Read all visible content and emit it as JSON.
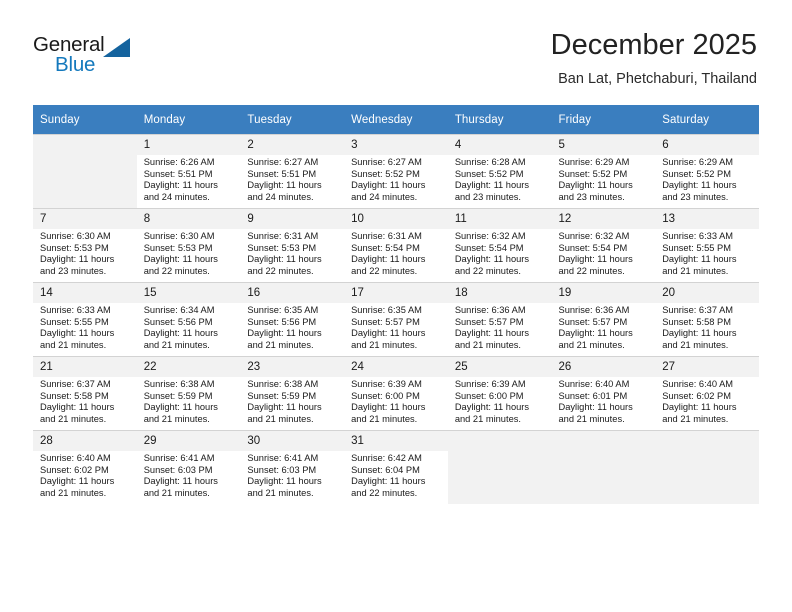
{
  "brand": {
    "name_top": "General",
    "name_bottom": "Blue",
    "accent_color": "#1479bd",
    "triangle_color": "#14639e"
  },
  "header": {
    "month_title": "December 2025",
    "location": "Ban Lat, Phetchaburi, Thailand"
  },
  "calendar": {
    "header_bg": "#3a7ebf",
    "weekday_headers": [
      "Sunday",
      "Monday",
      "Tuesday",
      "Wednesday",
      "Thursday",
      "Friday",
      "Saturday"
    ],
    "weeks": [
      [
        {
          "day": "",
          "sunrise": "",
          "sunset": "",
          "daylight_line1": "",
          "daylight_line2": ""
        },
        {
          "day": "1",
          "sunrise": "Sunrise: 6:26 AM",
          "sunset": "Sunset: 5:51 PM",
          "daylight_line1": "Daylight: 11 hours",
          "daylight_line2": "and 24 minutes."
        },
        {
          "day": "2",
          "sunrise": "Sunrise: 6:27 AM",
          "sunset": "Sunset: 5:51 PM",
          "daylight_line1": "Daylight: 11 hours",
          "daylight_line2": "and 24 minutes."
        },
        {
          "day": "3",
          "sunrise": "Sunrise: 6:27 AM",
          "sunset": "Sunset: 5:52 PM",
          "daylight_line1": "Daylight: 11 hours",
          "daylight_line2": "and 24 minutes."
        },
        {
          "day": "4",
          "sunrise": "Sunrise: 6:28 AM",
          "sunset": "Sunset: 5:52 PM",
          "daylight_line1": "Daylight: 11 hours",
          "daylight_line2": "and 23 minutes."
        },
        {
          "day": "5",
          "sunrise": "Sunrise: 6:29 AM",
          "sunset": "Sunset: 5:52 PM",
          "daylight_line1": "Daylight: 11 hours",
          "daylight_line2": "and 23 minutes."
        },
        {
          "day": "6",
          "sunrise": "Sunrise: 6:29 AM",
          "sunset": "Sunset: 5:52 PM",
          "daylight_line1": "Daylight: 11 hours",
          "daylight_line2": "and 23 minutes."
        }
      ],
      [
        {
          "day": "7",
          "sunrise": "Sunrise: 6:30 AM",
          "sunset": "Sunset: 5:53 PM",
          "daylight_line1": "Daylight: 11 hours",
          "daylight_line2": "and 23 minutes."
        },
        {
          "day": "8",
          "sunrise": "Sunrise: 6:30 AM",
          "sunset": "Sunset: 5:53 PM",
          "daylight_line1": "Daylight: 11 hours",
          "daylight_line2": "and 22 minutes."
        },
        {
          "day": "9",
          "sunrise": "Sunrise: 6:31 AM",
          "sunset": "Sunset: 5:53 PM",
          "daylight_line1": "Daylight: 11 hours",
          "daylight_line2": "and 22 minutes."
        },
        {
          "day": "10",
          "sunrise": "Sunrise: 6:31 AM",
          "sunset": "Sunset: 5:54 PM",
          "daylight_line1": "Daylight: 11 hours",
          "daylight_line2": "and 22 minutes."
        },
        {
          "day": "11",
          "sunrise": "Sunrise: 6:32 AM",
          "sunset": "Sunset: 5:54 PM",
          "daylight_line1": "Daylight: 11 hours",
          "daylight_line2": "and 22 minutes."
        },
        {
          "day": "12",
          "sunrise": "Sunrise: 6:32 AM",
          "sunset": "Sunset: 5:54 PM",
          "daylight_line1": "Daylight: 11 hours",
          "daylight_line2": "and 22 minutes."
        },
        {
          "day": "13",
          "sunrise": "Sunrise: 6:33 AM",
          "sunset": "Sunset: 5:55 PM",
          "daylight_line1": "Daylight: 11 hours",
          "daylight_line2": "and 21 minutes."
        }
      ],
      [
        {
          "day": "14",
          "sunrise": "Sunrise: 6:33 AM",
          "sunset": "Sunset: 5:55 PM",
          "daylight_line1": "Daylight: 11 hours",
          "daylight_line2": "and 21 minutes."
        },
        {
          "day": "15",
          "sunrise": "Sunrise: 6:34 AM",
          "sunset": "Sunset: 5:56 PM",
          "daylight_line1": "Daylight: 11 hours",
          "daylight_line2": "and 21 minutes."
        },
        {
          "day": "16",
          "sunrise": "Sunrise: 6:35 AM",
          "sunset": "Sunset: 5:56 PM",
          "daylight_line1": "Daylight: 11 hours",
          "daylight_line2": "and 21 minutes."
        },
        {
          "day": "17",
          "sunrise": "Sunrise: 6:35 AM",
          "sunset": "Sunset: 5:57 PM",
          "daylight_line1": "Daylight: 11 hours",
          "daylight_line2": "and 21 minutes."
        },
        {
          "day": "18",
          "sunrise": "Sunrise: 6:36 AM",
          "sunset": "Sunset: 5:57 PM",
          "daylight_line1": "Daylight: 11 hours",
          "daylight_line2": "and 21 minutes."
        },
        {
          "day": "19",
          "sunrise": "Sunrise: 6:36 AM",
          "sunset": "Sunset: 5:57 PM",
          "daylight_line1": "Daylight: 11 hours",
          "daylight_line2": "and 21 minutes."
        },
        {
          "day": "20",
          "sunrise": "Sunrise: 6:37 AM",
          "sunset": "Sunset: 5:58 PM",
          "daylight_line1": "Daylight: 11 hours",
          "daylight_line2": "and 21 minutes."
        }
      ],
      [
        {
          "day": "21",
          "sunrise": "Sunrise: 6:37 AM",
          "sunset": "Sunset: 5:58 PM",
          "daylight_line1": "Daylight: 11 hours",
          "daylight_line2": "and 21 minutes."
        },
        {
          "day": "22",
          "sunrise": "Sunrise: 6:38 AM",
          "sunset": "Sunset: 5:59 PM",
          "daylight_line1": "Daylight: 11 hours",
          "daylight_line2": "and 21 minutes."
        },
        {
          "day": "23",
          "sunrise": "Sunrise: 6:38 AM",
          "sunset": "Sunset: 5:59 PM",
          "daylight_line1": "Daylight: 11 hours",
          "daylight_line2": "and 21 minutes."
        },
        {
          "day": "24",
          "sunrise": "Sunrise: 6:39 AM",
          "sunset": "Sunset: 6:00 PM",
          "daylight_line1": "Daylight: 11 hours",
          "daylight_line2": "and 21 minutes."
        },
        {
          "day": "25",
          "sunrise": "Sunrise: 6:39 AM",
          "sunset": "Sunset: 6:00 PM",
          "daylight_line1": "Daylight: 11 hours",
          "daylight_line2": "and 21 minutes."
        },
        {
          "day": "26",
          "sunrise": "Sunrise: 6:40 AM",
          "sunset": "Sunset: 6:01 PM",
          "daylight_line1": "Daylight: 11 hours",
          "daylight_line2": "and 21 minutes."
        },
        {
          "day": "27",
          "sunrise": "Sunrise: 6:40 AM",
          "sunset": "Sunset: 6:02 PM",
          "daylight_line1": "Daylight: 11 hours",
          "daylight_line2": "and 21 minutes."
        }
      ],
      [
        {
          "day": "28",
          "sunrise": "Sunrise: 6:40 AM",
          "sunset": "Sunset: 6:02 PM",
          "daylight_line1": "Daylight: 11 hours",
          "daylight_line2": "and 21 minutes."
        },
        {
          "day": "29",
          "sunrise": "Sunrise: 6:41 AM",
          "sunset": "Sunset: 6:03 PM",
          "daylight_line1": "Daylight: 11 hours",
          "daylight_line2": "and 21 minutes."
        },
        {
          "day": "30",
          "sunrise": "Sunrise: 6:41 AM",
          "sunset": "Sunset: 6:03 PM",
          "daylight_line1": "Daylight: 11 hours",
          "daylight_line2": "and 21 minutes."
        },
        {
          "day": "31",
          "sunrise": "Sunrise: 6:42 AM",
          "sunset": "Sunset: 6:04 PM",
          "daylight_line1": "Daylight: 11 hours",
          "daylight_line2": "and 22 minutes."
        },
        {
          "day": "",
          "sunrise": "",
          "sunset": "",
          "daylight_line1": "",
          "daylight_line2": ""
        },
        {
          "day": "",
          "sunrise": "",
          "sunset": "",
          "daylight_line1": "",
          "daylight_line2": ""
        },
        {
          "day": "",
          "sunrise": "",
          "sunset": "",
          "daylight_line1": "",
          "daylight_line2": ""
        }
      ]
    ]
  }
}
